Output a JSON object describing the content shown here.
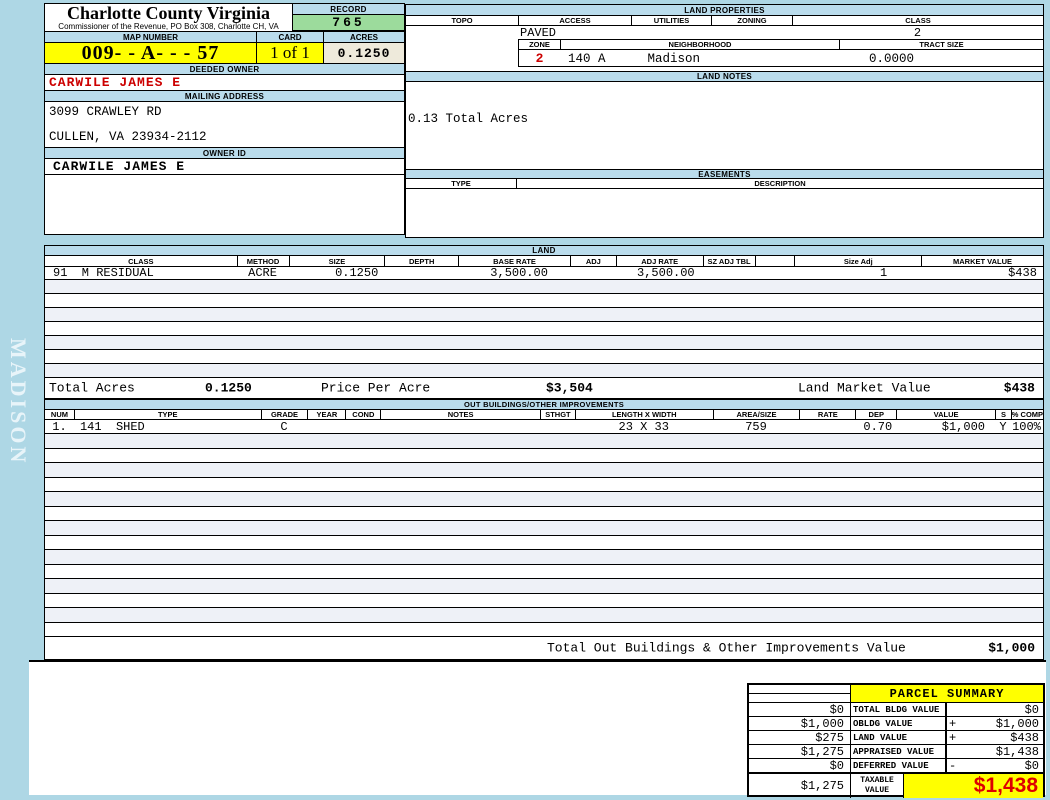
{
  "page": {
    "sidebar_label": "MADISON"
  },
  "colors": {
    "page_bg": "#aed7e5",
    "hdr_blue": "#badcec",
    "yellow": "#ffff00",
    "green": "#9cdb9c",
    "cream": "#eeeadb",
    "owner_red": "#cc0000",
    "big_red": "#dd0000",
    "tint": "#eef1f7"
  },
  "header": {
    "county_title": "Charlotte County Virginia",
    "commissioner_line": "Commissioner of the Revenue, PO  Box 308, Charlotte CH, VA",
    "record": {
      "label": "RECORD",
      "value": "765"
    },
    "map_number": {
      "label": "MAP NUMBER",
      "value": "009-  - A-   -   - 57"
    },
    "card": {
      "label": "CARD",
      "value": "1 of 1"
    },
    "acres": {
      "label": "ACRES",
      "value": "0.1250"
    },
    "deeded_owner": {
      "label": "DEEDED OWNER",
      "value": "CARWILE JAMES E"
    },
    "mailing_address": {
      "label": "MAILING ADDRESS",
      "line1": "3099 CRAWLEY RD",
      "line2": "CULLEN, VA 23934-2112"
    },
    "owner_id": {
      "label": "OWNER ID",
      "value": "CARWILE JAMES E"
    }
  },
  "land_properties": {
    "title": "LAND PROPERTIES",
    "columns": [
      "TOPO",
      "ACCESS",
      "UTILITIES",
      "ZONING",
      "CLASS"
    ],
    "values": {
      "topo": "",
      "access": "PAVED",
      "utilities": "",
      "zoning": "",
      "class": "2"
    },
    "zone_row": {
      "zone_label": "ZONE",
      "zone": "2",
      "neighborhood_label": "NEIGHBORHOOD",
      "neighborhood_code": "140 A",
      "neighborhood_name": "Madison",
      "tract_size_label": "TRACT SIZE",
      "tract_size": "0.0000"
    }
  },
  "land_notes": {
    "title": "LAND NOTES",
    "note": "0.13 Total Acres"
  },
  "easements": {
    "title": "EASEMENTS",
    "columns": [
      "TYPE",
      "DESCRIPTION"
    ]
  },
  "land_table": {
    "title": "LAND",
    "columns": [
      "CLASS",
      "METHOD",
      "SIZE",
      "DEPTH",
      "BASE RATE",
      "ADJ",
      "ADJ RATE",
      "SZ ADJ TBL",
      "",
      "Size Adj",
      "MARKET VALUE"
    ],
    "rows": [
      [
        "91  M RESIDUAL",
        "ACRE",
        "0.1250",
        "",
        "3,500.00",
        "",
        "3,500.00",
        "",
        "",
        "1",
        "$438"
      ]
    ],
    "empty_row_count": 7,
    "totals": {
      "total_acres_label": "Total Acres",
      "total_acres": "0.1250",
      "price_per_acre_label": "Price Per Acre",
      "price_per_acre": "$3,504",
      "land_market_value_label": "Land Market Value",
      "land_market_value": "$438"
    }
  },
  "outbuildings_table": {
    "title": "OUT BUILDINGS/OTHER IMPROVEMENTS",
    "columns": [
      "NUM",
      "TYPE",
      "GRADE",
      "YEAR",
      "COND",
      "NOTES",
      "STHGT",
      "LENGTH X WIDTH",
      "AREA/SIZE",
      "RATE",
      "DEP",
      "VALUE",
      "S",
      "% COMP"
    ],
    "rows": [
      [
        "1.",
        "141  SHED",
        "C",
        "",
        "",
        "",
        "",
        "23 X 33",
        "759",
        "",
        "0.70",
        "$1,000",
        "Y",
        "100%"
      ]
    ],
    "empty_row_count": 14,
    "total_label": "Total Out Buildings & Other Improvements Value",
    "total_value": "$1,000"
  },
  "parcel_summary": {
    "title": "PARCEL SUMMARY",
    "rows": [
      {
        "prior": "$0",
        "label": "TOTAL BLDG VALUE",
        "sign": "",
        "value": "$0"
      },
      {
        "prior": "$1,000",
        "label": "OBLDG VALUE",
        "sign": "+",
        "value": "$1,000"
      },
      {
        "prior": "$275",
        "label": "LAND VALUE",
        "sign": "+",
        "value": "$438"
      },
      {
        "prior": "$1,275",
        "label": "APPRAISED VALUE",
        "sign": "",
        "value": "$1,438"
      },
      {
        "prior": "$0",
        "label": "DEFERRED VALUE",
        "sign": "-",
        "value": "$0"
      },
      {
        "prior": "$1,275",
        "label": "TAXABLE VALUE",
        "sign": "",
        "value": "$1,438"
      }
    ]
  }
}
